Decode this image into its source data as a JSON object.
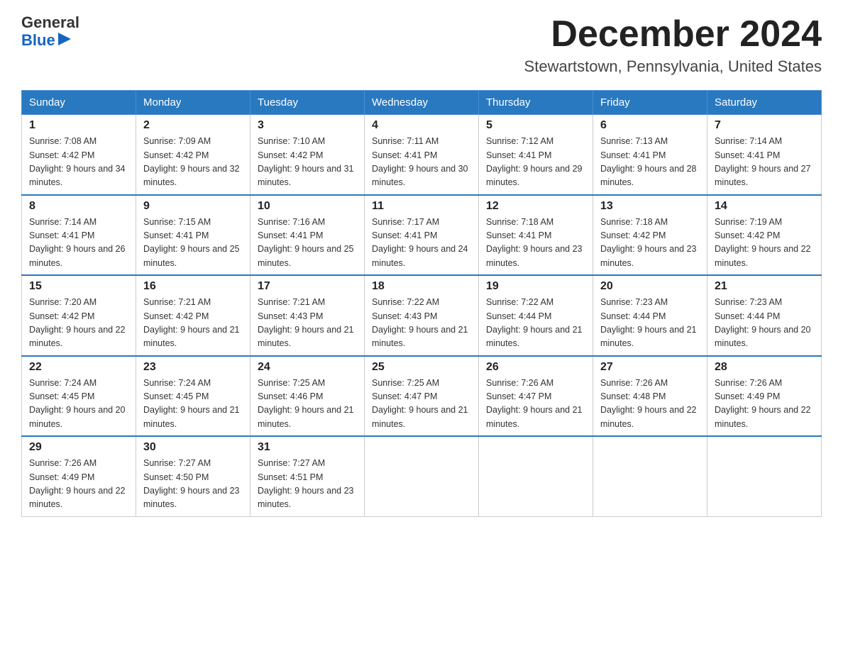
{
  "header": {
    "logo_text_general": "General",
    "logo_text_blue": "Blue",
    "title": "December 2024",
    "subtitle": "Stewartstown, Pennsylvania, United States"
  },
  "days_of_week": [
    "Sunday",
    "Monday",
    "Tuesday",
    "Wednesday",
    "Thursday",
    "Friday",
    "Saturday"
  ],
  "weeks": [
    [
      {
        "day": "1",
        "sunrise": "7:08 AM",
        "sunset": "4:42 PM",
        "daylight": "9 hours and 34 minutes."
      },
      {
        "day": "2",
        "sunrise": "7:09 AM",
        "sunset": "4:42 PM",
        "daylight": "9 hours and 32 minutes."
      },
      {
        "day": "3",
        "sunrise": "7:10 AM",
        "sunset": "4:42 PM",
        "daylight": "9 hours and 31 minutes."
      },
      {
        "day": "4",
        "sunrise": "7:11 AM",
        "sunset": "4:41 PM",
        "daylight": "9 hours and 30 minutes."
      },
      {
        "day": "5",
        "sunrise": "7:12 AM",
        "sunset": "4:41 PM",
        "daylight": "9 hours and 29 minutes."
      },
      {
        "day": "6",
        "sunrise": "7:13 AM",
        "sunset": "4:41 PM",
        "daylight": "9 hours and 28 minutes."
      },
      {
        "day": "7",
        "sunrise": "7:14 AM",
        "sunset": "4:41 PM",
        "daylight": "9 hours and 27 minutes."
      }
    ],
    [
      {
        "day": "8",
        "sunrise": "7:14 AM",
        "sunset": "4:41 PM",
        "daylight": "9 hours and 26 minutes."
      },
      {
        "day": "9",
        "sunrise": "7:15 AM",
        "sunset": "4:41 PM",
        "daylight": "9 hours and 25 minutes."
      },
      {
        "day": "10",
        "sunrise": "7:16 AM",
        "sunset": "4:41 PM",
        "daylight": "9 hours and 25 minutes."
      },
      {
        "day": "11",
        "sunrise": "7:17 AM",
        "sunset": "4:41 PM",
        "daylight": "9 hours and 24 minutes."
      },
      {
        "day": "12",
        "sunrise": "7:18 AM",
        "sunset": "4:41 PM",
        "daylight": "9 hours and 23 minutes."
      },
      {
        "day": "13",
        "sunrise": "7:18 AM",
        "sunset": "4:42 PM",
        "daylight": "9 hours and 23 minutes."
      },
      {
        "day": "14",
        "sunrise": "7:19 AM",
        "sunset": "4:42 PM",
        "daylight": "9 hours and 22 minutes."
      }
    ],
    [
      {
        "day": "15",
        "sunrise": "7:20 AM",
        "sunset": "4:42 PM",
        "daylight": "9 hours and 22 minutes."
      },
      {
        "day": "16",
        "sunrise": "7:21 AM",
        "sunset": "4:42 PM",
        "daylight": "9 hours and 21 minutes."
      },
      {
        "day": "17",
        "sunrise": "7:21 AM",
        "sunset": "4:43 PM",
        "daylight": "9 hours and 21 minutes."
      },
      {
        "day": "18",
        "sunrise": "7:22 AM",
        "sunset": "4:43 PM",
        "daylight": "9 hours and 21 minutes."
      },
      {
        "day": "19",
        "sunrise": "7:22 AM",
        "sunset": "4:44 PM",
        "daylight": "9 hours and 21 minutes."
      },
      {
        "day": "20",
        "sunrise": "7:23 AM",
        "sunset": "4:44 PM",
        "daylight": "9 hours and 21 minutes."
      },
      {
        "day": "21",
        "sunrise": "7:23 AM",
        "sunset": "4:44 PM",
        "daylight": "9 hours and 20 minutes."
      }
    ],
    [
      {
        "day": "22",
        "sunrise": "7:24 AM",
        "sunset": "4:45 PM",
        "daylight": "9 hours and 20 minutes."
      },
      {
        "day": "23",
        "sunrise": "7:24 AM",
        "sunset": "4:45 PM",
        "daylight": "9 hours and 21 minutes."
      },
      {
        "day": "24",
        "sunrise": "7:25 AM",
        "sunset": "4:46 PM",
        "daylight": "9 hours and 21 minutes."
      },
      {
        "day": "25",
        "sunrise": "7:25 AM",
        "sunset": "4:47 PM",
        "daylight": "9 hours and 21 minutes."
      },
      {
        "day": "26",
        "sunrise": "7:26 AM",
        "sunset": "4:47 PM",
        "daylight": "9 hours and 21 minutes."
      },
      {
        "day": "27",
        "sunrise": "7:26 AM",
        "sunset": "4:48 PM",
        "daylight": "9 hours and 22 minutes."
      },
      {
        "day": "28",
        "sunrise": "7:26 AM",
        "sunset": "4:49 PM",
        "daylight": "9 hours and 22 minutes."
      }
    ],
    [
      {
        "day": "29",
        "sunrise": "7:26 AM",
        "sunset": "4:49 PM",
        "daylight": "9 hours and 22 minutes."
      },
      {
        "day": "30",
        "sunrise": "7:27 AM",
        "sunset": "4:50 PM",
        "daylight": "9 hours and 23 minutes."
      },
      {
        "day": "31",
        "sunrise": "7:27 AM",
        "sunset": "4:51 PM",
        "daylight": "9 hours and 23 minutes."
      },
      null,
      null,
      null,
      null
    ]
  ]
}
